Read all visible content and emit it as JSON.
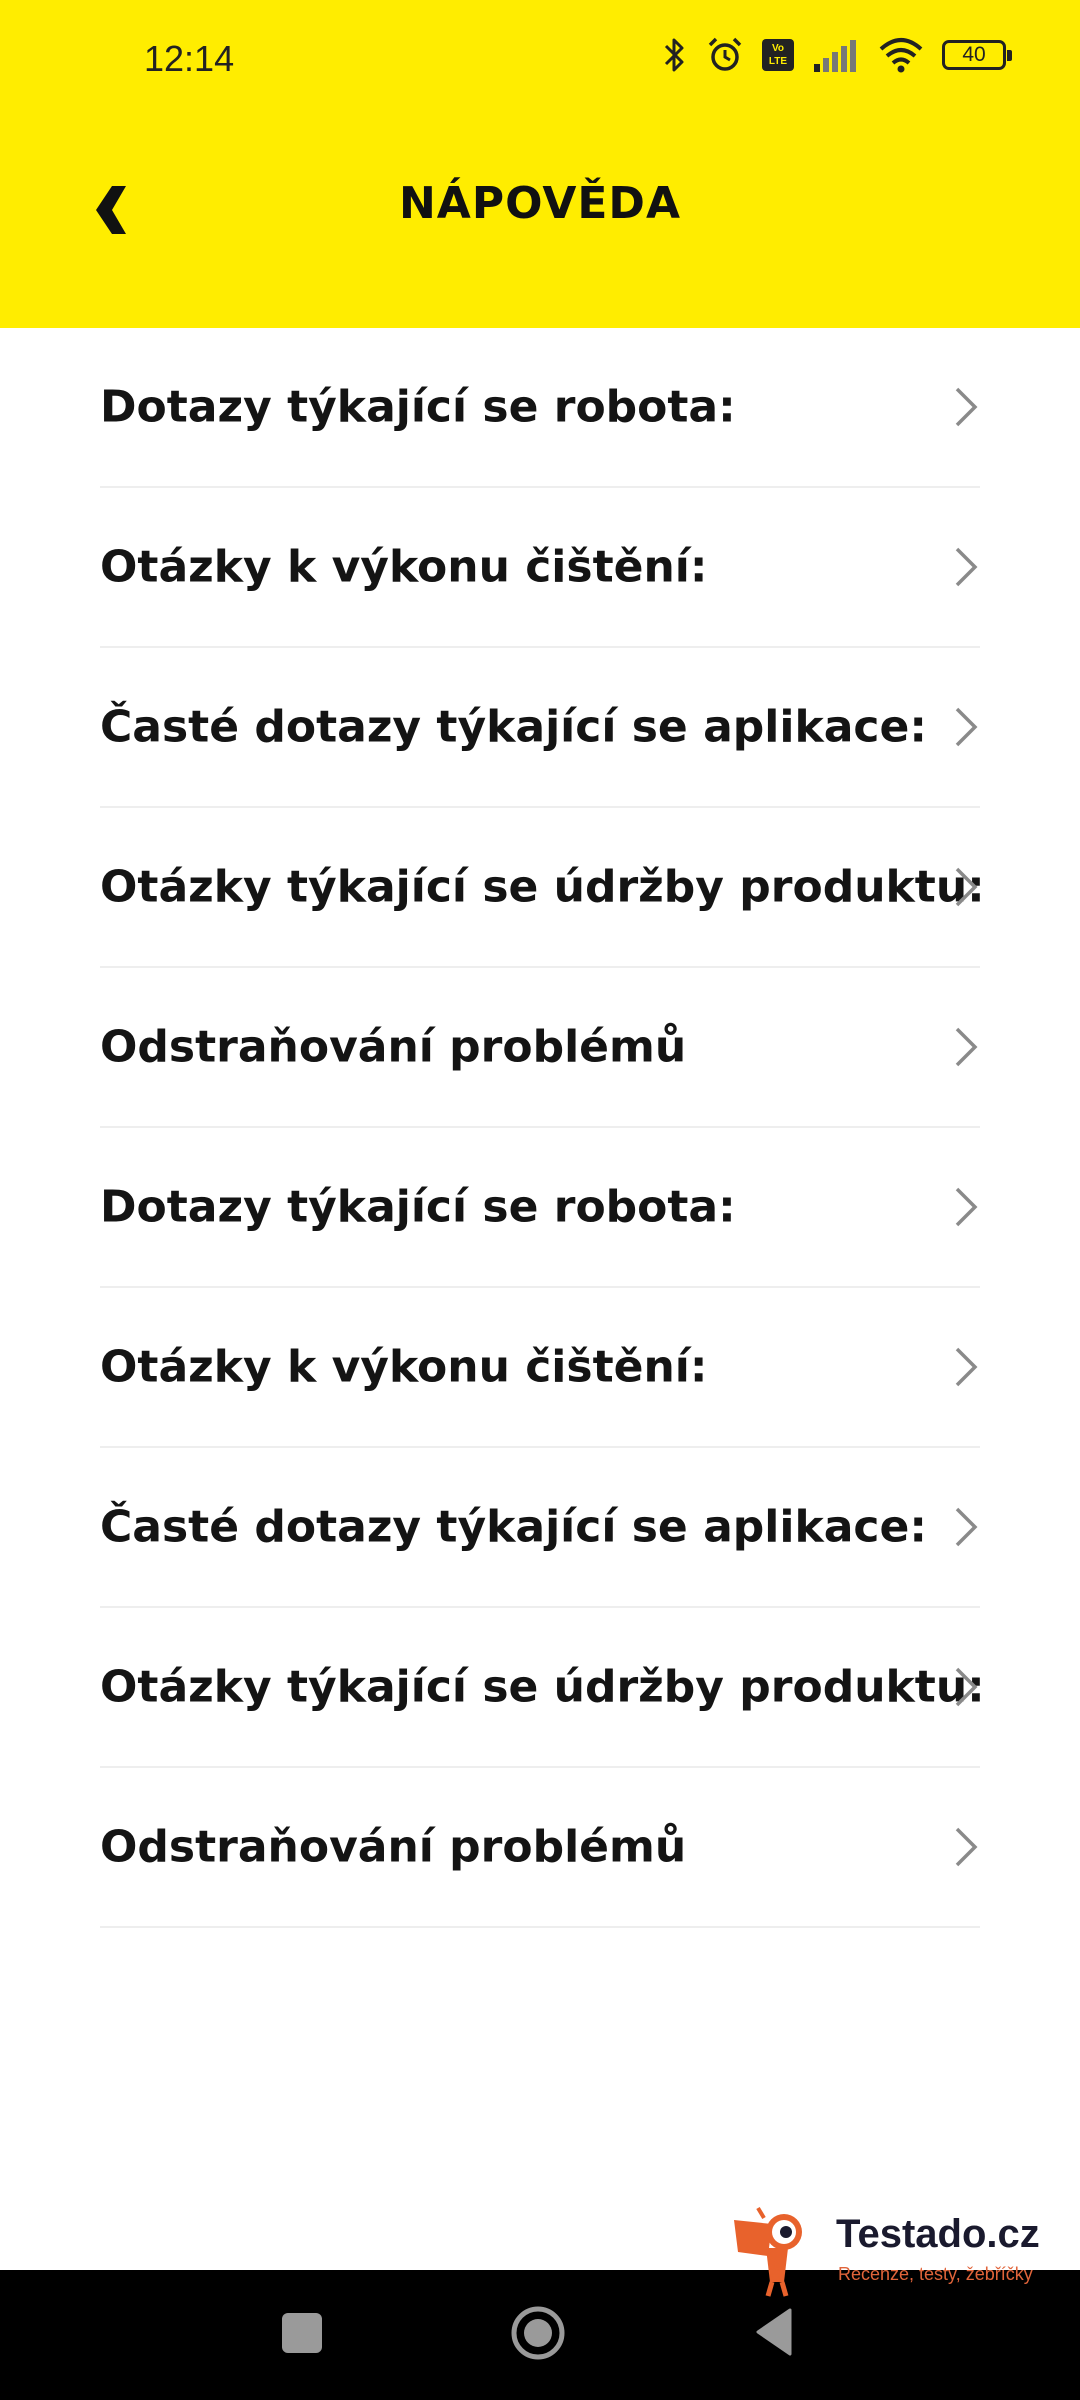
{
  "status_bar": {
    "time": "12:14",
    "battery": "40",
    "volte_top": "Vo",
    "volte_bottom": "LTE"
  },
  "header": {
    "title": "NÁPOVĚDA",
    "background": "#FFED00"
  },
  "help_items": [
    {
      "label": "Dotazy týkající se robota:"
    },
    {
      "label": "Otázky k výkonu čištění:"
    },
    {
      "label": "Časté dotazy týkající se aplikace:"
    },
    {
      "label": "Otázky týkající se údržby produktu:"
    },
    {
      "label": "Odstraňování problémů"
    },
    {
      "label": "Dotazy týkající se robota:"
    },
    {
      "label": "Otázky k výkonu čištění:"
    },
    {
      "label": "Časté dotazy týkající se aplikace:"
    },
    {
      "label": "Otázky týkající se údržby produktu:"
    },
    {
      "label": "Odstraňování problémů"
    }
  ],
  "watermark": {
    "title": "Testado.cz",
    "subtitle": "Recenze, testy, žebříčky"
  },
  "icons": {
    "back": "chevron-left-icon",
    "row": "chevron-right-icon",
    "nav": [
      "recents-icon",
      "home-icon",
      "back-triangle-icon"
    ]
  }
}
